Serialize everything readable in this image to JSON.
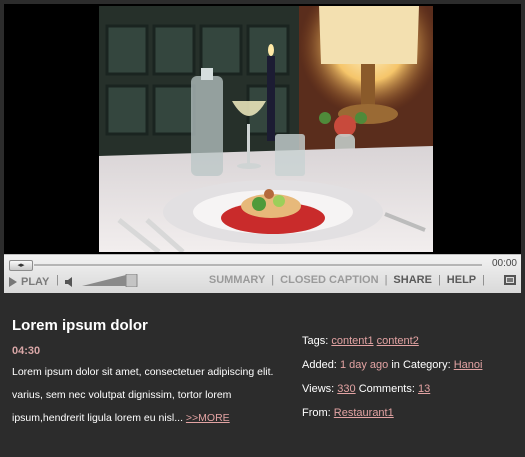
{
  "controls": {
    "time": "00:00",
    "play_label": "PLAY",
    "separator": "|",
    "summary_label": "SUMMARY",
    "closed_caption_label": "CLOSED CAPTION",
    "share_label": "SHARE",
    "help_label": "HELP",
    "scrub_handle_glyph": "◂▸"
  },
  "info": {
    "title": "Lorem ipsum dolor",
    "duration": "04:30",
    "description": "Lorem ipsum dolor sit amet, consectetuer adipiscing elit. varius, sem nec volutpat dignissim, tortor lorem ipsum,hendrerit ligula lorem eu nisl... ",
    "more_label": ">>MORE"
  },
  "meta": {
    "tags_label": "Tags:",
    "tags": [
      "content1",
      "content2"
    ],
    "added_label": "Added:",
    "added_value": "1 day ago",
    "category_label": "in Category:",
    "category_value": "Hanoi",
    "views_label": "Views:",
    "views_value": "330",
    "comments_label": "Comments:",
    "comments_value": "13",
    "from_label": "From:",
    "from_value": "Restaurant1"
  },
  "colors": {
    "accent_link": "#e3a3a3",
    "panel_bg": "#2c2c2c",
    "controls_bg": "#e5e5e5"
  }
}
